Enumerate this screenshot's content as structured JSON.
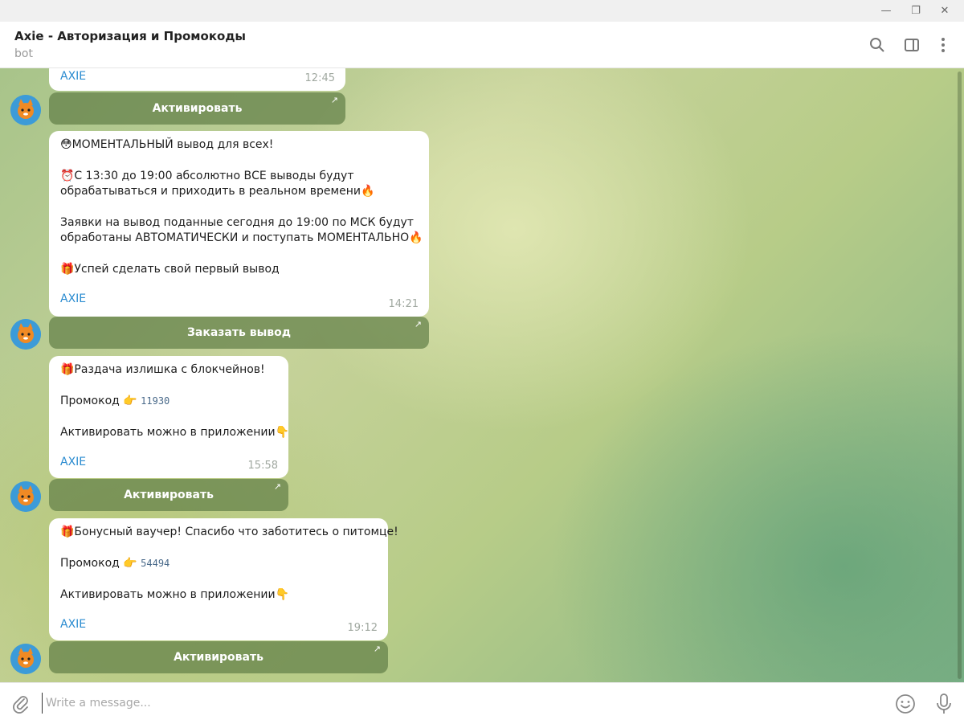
{
  "window": {
    "minimize": "—",
    "restore": "❐",
    "close": "✕"
  },
  "header": {
    "title": "Axie - Авторизация и Промокоды",
    "subtitle": "bot"
  },
  "messages": [
    {
      "lines": [],
      "link": "AXIE",
      "time": "12:45",
      "button": "Активировать"
    },
    {
      "lines": [
        "😳МОМЕНТАЛЬНЫЙ вывод для всех!",
        "",
        "⏰С 13:30 до 19:00 абсолютно ВСЕ выводы будут",
        "обрабатываться и приходить в реальном времени🔥",
        "",
        "Заявки на вывод поданные сегодня до 19:00 по МСК будут",
        "обработаны АВТОМАТИЧЕСКИ и поступать МОМЕНТАЛЬНО🔥",
        "",
        "🎁Успей сделать свой первый вывод"
      ],
      "link": "AXIE",
      "time": "14:21",
      "button": "Заказать вывод"
    },
    {
      "lines": [
        "🎁Раздача излишка с блокчейнов!",
        "",
        "Промокод 👉",
        "",
        "Активировать можно в приложении👇"
      ],
      "promo_code": "11930",
      "link": "AXIE",
      "time": "15:58",
      "button": "Активировать"
    },
    {
      "lines": [
        "🎁Бонусный ваучер! Спасибо что заботитесь о питомце!",
        "",
        "Промокод 👉",
        "",
        "Активировать можно в приложении👇"
      ],
      "promo_code": "54494",
      "link": "AXIE",
      "time": "19:12",
      "button": "Активировать"
    }
  ],
  "composer": {
    "placeholder": "Write a message..."
  },
  "colors": {
    "accent": "#2a8bd0",
    "button_bg": "#628048",
    "bubble_bg": "#ffffff"
  },
  "icons": [
    "search-icon",
    "sidebar-toggle-icon",
    "more-vertical-icon",
    "paperclip-icon",
    "emoji-icon",
    "microphone-icon",
    "external-link-arrow-icon"
  ]
}
